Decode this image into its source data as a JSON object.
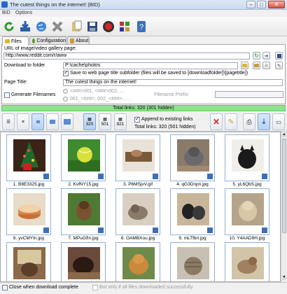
{
  "window": {
    "title": "The cutest things on the internet! (BID)"
  },
  "menu": [
    "BID",
    "Options"
  ],
  "toolbar_icons": [
    "refresh-icon",
    "download-arrow-icon",
    "globe-icon",
    "delete-x-icon",
    "copy-icon",
    "save-disk-icon",
    "record-icon",
    "gallery-grid-icon",
    "help-icon"
  ],
  "tabs": [
    {
      "label": "Files",
      "icon": "folder-icon",
      "active": true
    },
    {
      "label": "Configuration",
      "icon": "settings-icon",
      "active": false
    },
    {
      "label": "About",
      "icon": "book-icon",
      "active": false
    }
  ],
  "files": {
    "url_label": "URL of image/video gallery page:",
    "url_value": "http://www.reddit.com/r/aww",
    "download_label": "Download to folder",
    "download_value": "P:\\cache\\photos",
    "subfolder_check_label": "Save to web page title subfolder (files will be saved to [downloadfolder]\\[pagetitle])",
    "page_title_label": "Page Title:",
    "page_title_value": "The cutest things on the internet!",
    "generate_label": "Generate Filenames",
    "radio1": "<###>001, <###>002, ...",
    "radio2": "001_<###>, 002_<###>, ...",
    "prefix_label": "Filename Prefix:"
  },
  "status": {
    "total_links": "Total links: 320 (301 hidden)"
  },
  "view_toolbar": {
    "counts": [
      "320",
      "501",
      "821"
    ],
    "append_label": "Append to existing links",
    "total_links": "Total links: 320 (501 hidden)"
  },
  "gallery": {
    "items": [
      {
        "caption": "1. B8E3325.jpg",
        "scene": "christmas"
      },
      {
        "caption": "2. KvfNY15.jpg",
        "scene": "ball"
      },
      {
        "caption": "3. P6MSjxV.gif",
        "scene": "shelf"
      },
      {
        "caption": "4. qG3Dnpn.jpg",
        "scene": "dog-grey"
      },
      {
        "caption": "5. yL6QbS.jpg",
        "scene": "black-cat"
      },
      {
        "caption": "6. yvCMYIn.jpg",
        "scene": "cake"
      },
      {
        "caption": "7. MPuGfIn.jpg",
        "scene": "puppy-grass"
      },
      {
        "caption": "8. OAMBXou.jpg",
        "scene": "kitten"
      },
      {
        "caption": "9. mLTfbri.jpg",
        "scene": "dogs-floor"
      },
      {
        "caption": "10. Y4AAD9H.jpg",
        "scene": "dog-beige"
      },
      {
        "caption": "",
        "scene": "cat-window"
      },
      {
        "caption": "",
        "scene": "pet-couch"
      },
      {
        "caption": "",
        "scene": "golden-dog"
      },
      {
        "caption": "",
        "scene": "tabby-cat"
      },
      {
        "caption": "",
        "scene": "cat-blanket"
      }
    ]
  },
  "footer": {
    "close_label": "Close when download complete",
    "only_label": "But only if all files downloaded successfully"
  },
  "colors": {
    "status_green": "#8ee38e",
    "accent_blue": "#3d6fb8"
  }
}
